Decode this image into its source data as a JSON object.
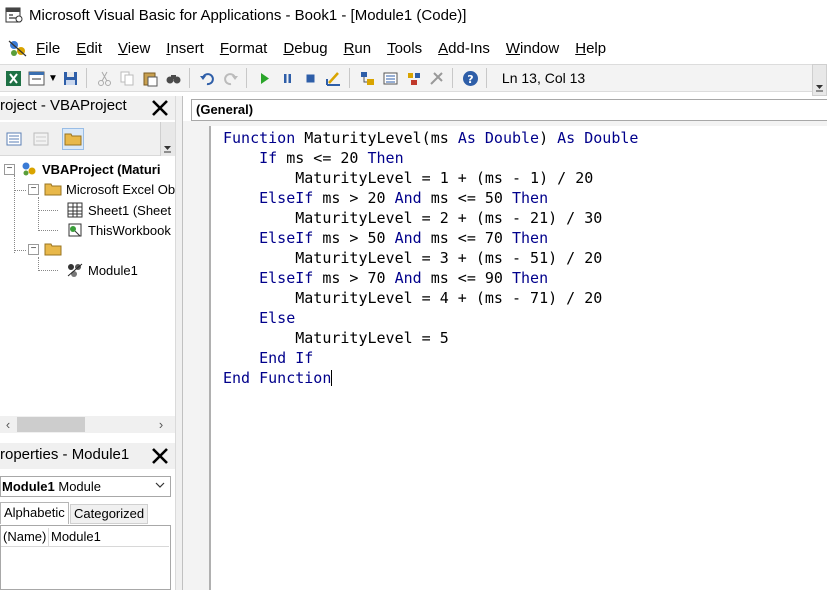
{
  "window": {
    "title": "Microsoft Visual Basic for Applications - Book1 - [Module1 (Code)]"
  },
  "menu": {
    "items": [
      "File",
      "Edit",
      "View",
      "Insert",
      "Format",
      "Debug",
      "Run",
      "Tools",
      "Add-Ins",
      "Window",
      "Help"
    ]
  },
  "toolbar": {
    "status": "Ln 13, Col 13",
    "icons": [
      "excel-view-icon",
      "insert-userform-icon",
      "save-icon",
      "cut-icon",
      "copy-icon",
      "paste-icon",
      "find-icon",
      "undo-icon",
      "redo-icon",
      "run-icon",
      "break-icon",
      "reset-icon",
      "design-mode-icon",
      "project-explorer-icon",
      "properties-window-icon",
      "object-browser-icon",
      "toolbox-icon",
      "help-icon"
    ]
  },
  "project": {
    "title": "roject - VBAProject",
    "tree": {
      "root": "VBAProject (Maturi",
      "excel_objects": "Microsoft Excel Ob",
      "sheet1": "Sheet1 (Sheet",
      "thisworkbook": "ThisWorkbook",
      "module1": "Module1"
    }
  },
  "properties": {
    "title": "roperties - Module1",
    "combo_name": "Module1",
    "combo_type": "Module",
    "tabs": [
      "Alphabetic",
      "Categorized"
    ],
    "row": {
      "name": "(Name)",
      "value": "Module1"
    }
  },
  "code": {
    "object_combo": "(General)",
    "lines": [
      "Function MaturityLevel(ms As Double) As Double",
      "    If ms <= 20 Then",
      "        MaturityLevel = 1 + (ms - 1) / 20",
      "    ElseIf ms > 20 And ms <= 50 Then",
      "        MaturityLevel = 2 + (ms - 21) / 30",
      "    ElseIf ms > 50 And ms <= 70 Then",
      "        MaturityLevel = 3 + (ms - 51) / 20",
      "    ElseIf ms > 70 And ms <= 90 Then",
      "        MaturityLevel = 4 + (ms - 71) / 20",
      "    Else",
      "        MaturityLevel = 5",
      "    End If",
      "End Function"
    ]
  }
}
